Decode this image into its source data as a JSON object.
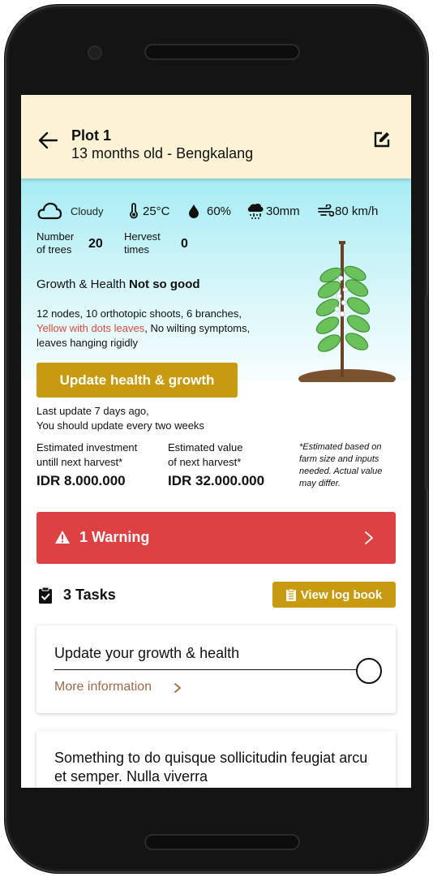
{
  "header": {
    "title": "Plot 1",
    "subtitle": "13 months old - Bengkalang"
  },
  "weather": {
    "condition": "Cloudy",
    "temperature": "25°C",
    "humidity": "60%",
    "rainfall": "30mm",
    "wind": "80 km/h"
  },
  "stats": {
    "trees_label_1": "Number",
    "trees_label_2": "of trees",
    "trees_value": "20",
    "harvest_label_1": "Hervest",
    "harvest_label_2": "times",
    "harvest_value": "0"
  },
  "growth": {
    "label": "Growth & Health",
    "status": "Not so good",
    "symptoms_1": "12 nodes, 10 orthotopic shoots, 6 branches,",
    "symptoms_red": "Yellow with dots leaves",
    "symptoms_2": ", No wilting symptoms,",
    "symptoms_3": "leaves hanging rigidly"
  },
  "update": {
    "button_label": "Update health & growth",
    "last_update": "Last update 7 days ago,",
    "frequency": "You should update every two weeks"
  },
  "estimates": {
    "investment_label_1": "Estimated investment",
    "investment_label_2": "untill next harvest*",
    "investment_value": "IDR 8.000.000",
    "value_label_1": "Estimated value",
    "value_label_2": "of next harvest*",
    "value_value": "IDR 32.000.000",
    "note": "*Estimated based on farm size and inputs needed. Actual value may differ."
  },
  "warning": {
    "label": "1 Warning",
    "color": "#de4143"
  },
  "tasks": {
    "label": "3 Tasks",
    "logbook_label": "View log book",
    "items": [
      {
        "title": "Update your growth & health",
        "more": "More information"
      },
      {
        "title": "Something to do quisque sollicitudin feugiat arcu et semper. Nulla viverra"
      }
    ]
  },
  "colors": {
    "accent": "#c79a10",
    "header_bg": "#fcf3d6",
    "hero_sky": "#a6ecf3"
  }
}
